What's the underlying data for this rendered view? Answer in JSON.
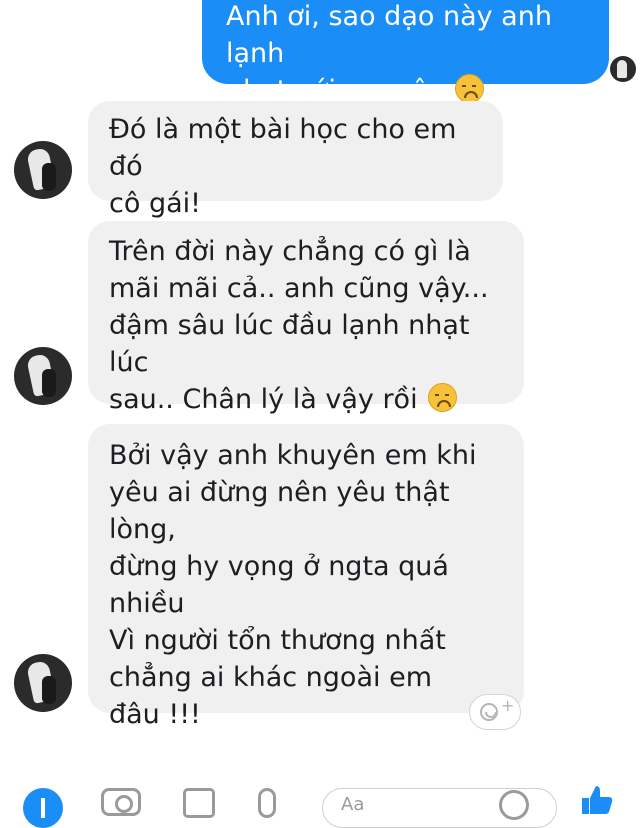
{
  "messages": [
    {
      "direction": "sent",
      "text": "Anh ơi, sao dạo này anh lạnh\nnhạt với em vậy",
      "emoji": "disappointed-face"
    },
    {
      "direction": "received",
      "text": "Đó là một bài học cho em đó\ncô gái!"
    },
    {
      "direction": "received",
      "text": "Trên đời này chẳng có gì là\nmãi mãi cả.. anh cũng vậy...\nđậm sâu lúc đầu lạnh nhạt lúc\nsau.. Chân lý là vậy rồi",
      "emoji": "disappointed-face"
    },
    {
      "direction": "received",
      "text": "Bởi vậy anh khuyên em khi\nyêu ai đừng nên yêu thật lòng,\nđừng hy vọng ở ngta quá\nnhiều\nVì người tổn thương nhất\nchẳng ai khác ngoài em\nđâu !!!"
    }
  ],
  "reaction_button": {
    "plus": "+"
  },
  "composer": {
    "placeholder": "Aa"
  },
  "colors": {
    "sent_bubble": "#1b8df6",
    "received_bubble": "#f1f0f0",
    "icon_gray": "#9a9a9a"
  },
  "icons": [
    "plus-icon",
    "camera-icon",
    "gallery-icon",
    "microphone-icon",
    "emoji-icon",
    "like-icon"
  ]
}
